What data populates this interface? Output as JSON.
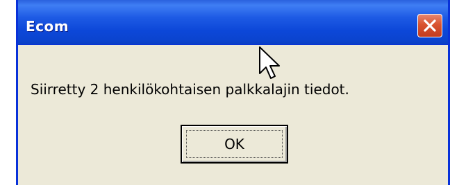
{
  "window": {
    "title": "Ecom",
    "close_icon": "close-icon"
  },
  "message": {
    "text": "Siirretty 2 henkilökohtaisen palkkalajin tiedot."
  },
  "buttons": {
    "ok_label": "OK"
  },
  "colors": {
    "titlebar_blue": "#0c47d8",
    "dialog_background": "#ece9d8",
    "close_red": "#d9542f"
  },
  "cursor": {
    "icon": "mouse-pointer-icon"
  }
}
